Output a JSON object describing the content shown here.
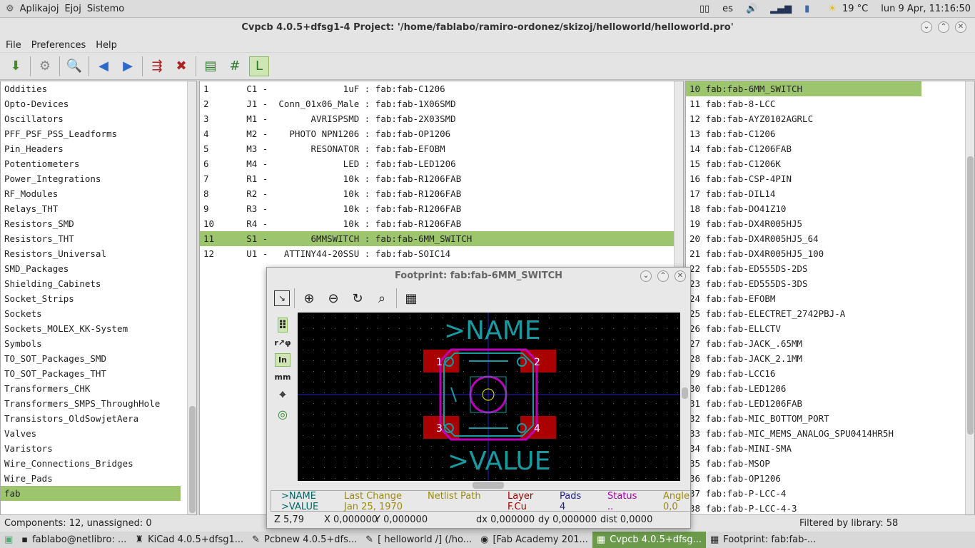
{
  "top_panel": {
    "menus": [
      "Aplikajoj",
      "Ejoj",
      "Sistemo"
    ],
    "lang": "es",
    "weather": "19 °C",
    "clock": "lun  9 Apr, 11:16:50"
  },
  "window": {
    "title": "Cvpcb 4.0.5+dfsg1-4  Project: '/home/fablabo/ramiro-ordonez/skizoj/helloworld/helloworld.pro'"
  },
  "menu": [
    "File",
    "Preferences",
    "Help"
  ],
  "libraries": [
    "Oddities",
    "Opto-Devices",
    "Oscillators",
    "PFF_PSF_PSS_Leadforms",
    "Pin_Headers",
    "Potentiometers",
    "Power_Integrations",
    "RF_Modules",
    "Relays_THT",
    "Resistors_SMD",
    "Resistors_THT",
    "Resistors_Universal",
    "SMD_Packages",
    "Shielding_Cabinets",
    "Socket_Strips",
    "Sockets",
    "Sockets_MOLEX_KK-System",
    "Symbols",
    "TO_SOT_Packages_SMD",
    "TO_SOT_Packages_THT",
    "Transformers_CHK",
    "Transformers_SMPS_ThroughHole",
    "Transistors_OldSowjetAera",
    "Valves",
    "Varistors",
    "Wire_Connections_Bridges",
    "Wire_Pads",
    "fab"
  ],
  "components": [
    "1       C1 -              1uF : fab:fab-C1206",
    "2       J1 -  Conn_01x06_Male : fab:fab-1X06SMD",
    "3       M1 -        AVRISPSMD : fab:fab-2X03SMD",
    "4       M2 -    PHOTO NPN1206 : fab:fab-OP1206",
    "5       M3 -        RESONATOR : fab:fab-EFOBM",
    "6       M4 -              LED : fab:fab-LED1206",
    "7       R1 -              10k : fab:fab-R1206FAB",
    "8       R2 -              10k : fab:fab-R1206FAB",
    "9       R3 -              10k : fab:fab-R1206FAB",
    "10      R4 -              10k : fab:fab-R1206FAB",
    "11      S1 -        6MMSWITCH : fab:fab-6MM_SWITCH",
    "12      U1 -   ATTINY44-20SSU : fab:fab-SOIC14"
  ],
  "footprints": [
    "10 fab:fab-6MM_SWITCH",
    "11 fab:fab-8-LCC",
    "12 fab:fab-AYZ0102AGRLC",
    "13 fab:fab-C1206",
    "14 fab:fab-C1206FAB",
    "15 fab:fab-C1206K",
    "16 fab:fab-CSP-4PIN",
    "17 fab:fab-DIL14",
    "18 fab:fab-DO41Z10",
    "19 fab:fab-DX4R005HJ5",
    "20 fab:fab-DX4R005HJ5_64",
    "21 fab:fab-DX4R005HJ5_100",
    "22 fab:fab-ED555DS-2DS",
    "23 fab:fab-ED555DS-3DS",
    "24 fab:fab-EFOBM",
    "25 fab:fab-ELECTRET_2742PBJ-A",
    "26 fab:fab-ELLCTV",
    "27 fab:fab-JACK_.65MM",
    "28 fab:fab-JACK_2.1MM",
    "29 fab:fab-LCC16",
    "30 fab:fab-LED1206",
    "31 fab:fab-LED1206FAB",
    "32 fab:fab-MIC_BOTTOM_PORT",
    "33 fab:fab-MIC_MEMS_ANALOG_SPU0414HR5H",
    "34 fab:fab-MINI-SMA",
    "35 fab:fab-MSOP",
    "36 fab:fab-OP1206",
    "37 fab:fab-P-LCC-4",
    "38 fab:fab-P-LCC-4-3"
  ],
  "status": {
    "left": "Components: 12, unassigned: 0",
    "right": "Filtered by library: 58"
  },
  "footprint_window": {
    "title": "Footprint: fab:fab-6MM_SWITCH",
    "name": ">NAME",
    "value": ">VALUE",
    "pads": [
      "1",
      "2",
      "3",
      "4"
    ],
    "msg": {
      "name": ">NAME",
      "value": ">VALUE",
      "last_change_label": "Last Change",
      "last_change": "Jan 25, 1970",
      "netlist_label": "Netlist Path",
      "layer_label": "Layer",
      "layer": "F.Cu",
      "pads_label": "Pads",
      "pads": "4",
      "status_label": "Status",
      "status": "..",
      "angle_label": "Angle",
      "angle": "0,0"
    },
    "units_in": "In",
    "units_mm": "mm",
    "status": {
      "zoom": "Z 5,79",
      "x": "X 0,000000",
      "y": "Y 0,000000",
      "dx": "dx 0,000000",
      "dy": "dy 0,000000",
      "dist": "dist 0,0000"
    }
  },
  "taskbar": [
    "fablabo@netlibro: ...",
    "KiCad 4.0.5+dfsg1...",
    "Pcbnew 4.0.5+dfs...",
    "[ helloworld /] (/ho...",
    "[Fab Academy 201...",
    "Cvpcb 4.0.5+dfsg...",
    "Footprint: fab:fab-..."
  ]
}
